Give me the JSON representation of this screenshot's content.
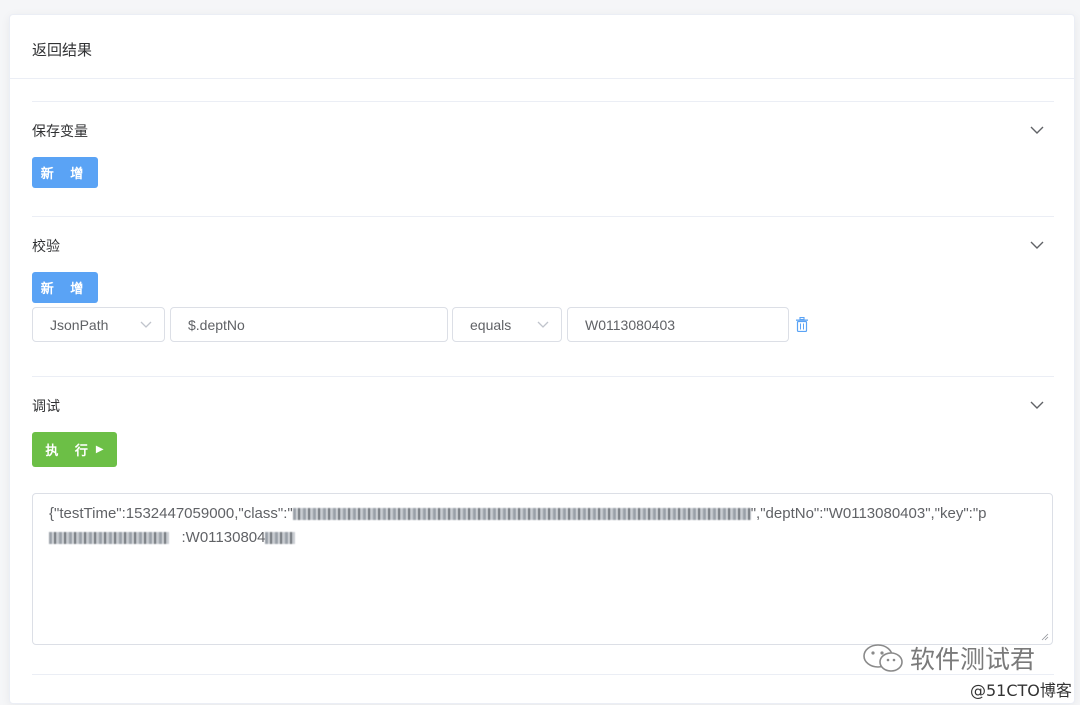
{
  "card": {
    "title": "返回结果"
  },
  "save_vars": {
    "title": "保存变量",
    "add_label": "新 增"
  },
  "validate": {
    "title": "校验",
    "add_label": "新 增",
    "row": {
      "type": "JsonPath",
      "expression": "$.deptNo",
      "comparator": "equals",
      "expected": "W0113080403"
    }
  },
  "debug": {
    "title": "调试",
    "run_label": "执 行",
    "output_line1_a": "{\"testTime\":1532447059000,\"class\":\"",
    "output_line1_b": "\",\"deptNo\":\"W0113080403\",\"key\":\"p",
    "output_line2_b": ":W01130804"
  },
  "watermark": {
    "brand": "软件测试君",
    "site": "@51CTO博客"
  },
  "colors": {
    "primary": "#5aa3f5",
    "success": "#6cbf46",
    "border": "#dcdfe6"
  },
  "icons": {
    "collapse": "chevron-down-icon",
    "delete": "trash-icon",
    "run": "play-icon"
  }
}
